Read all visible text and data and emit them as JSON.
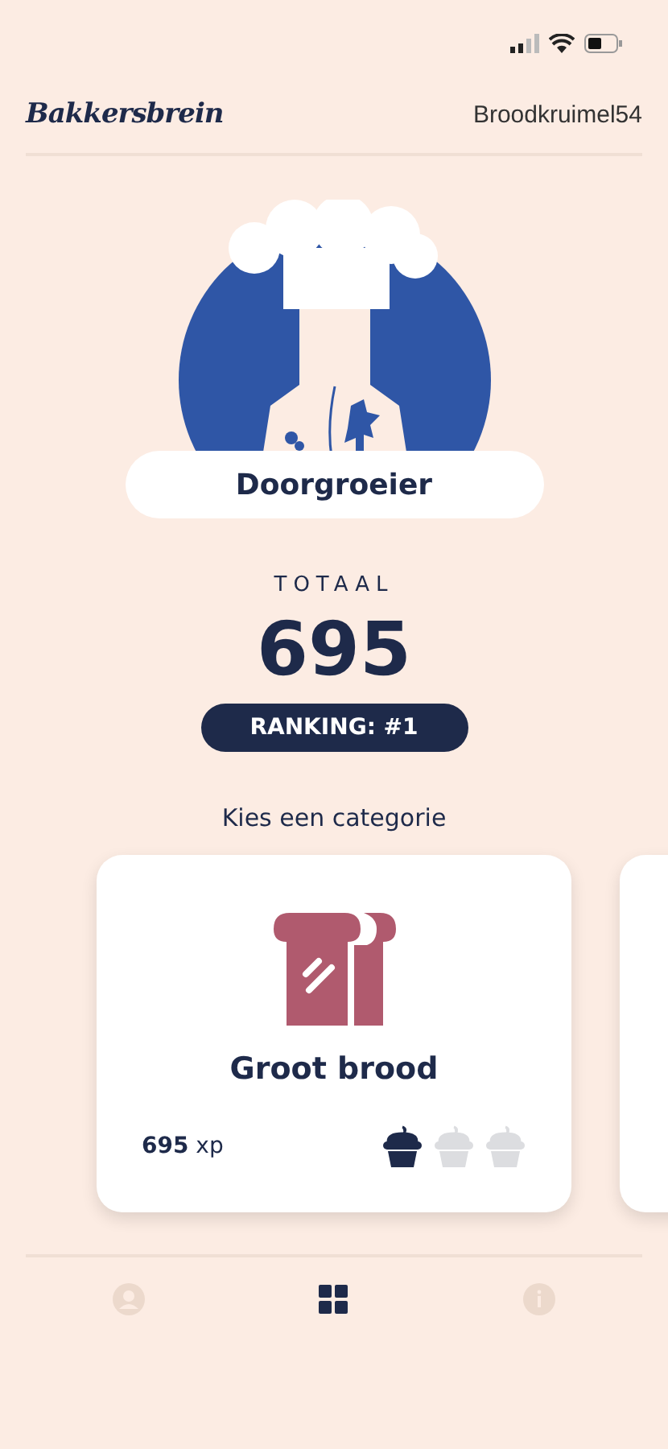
{
  "header": {
    "logo": "Bakkersbrein",
    "username": "Broodkruimel54"
  },
  "profile": {
    "level_title": "Doorgroeier",
    "total_label": "TOTAAL",
    "total": "695",
    "ranking": "RANKING: #1"
  },
  "category_prompt": "Kies een categorie",
  "categories": [
    {
      "name": "Groot brood",
      "xp": "695",
      "xp_unit": "xp",
      "stars": 1
    }
  ],
  "nav": [
    {
      "kind": "profile",
      "selected": false
    },
    {
      "kind": "grid",
      "selected": true
    },
    {
      "kind": "info",
      "selected": false
    }
  ]
}
